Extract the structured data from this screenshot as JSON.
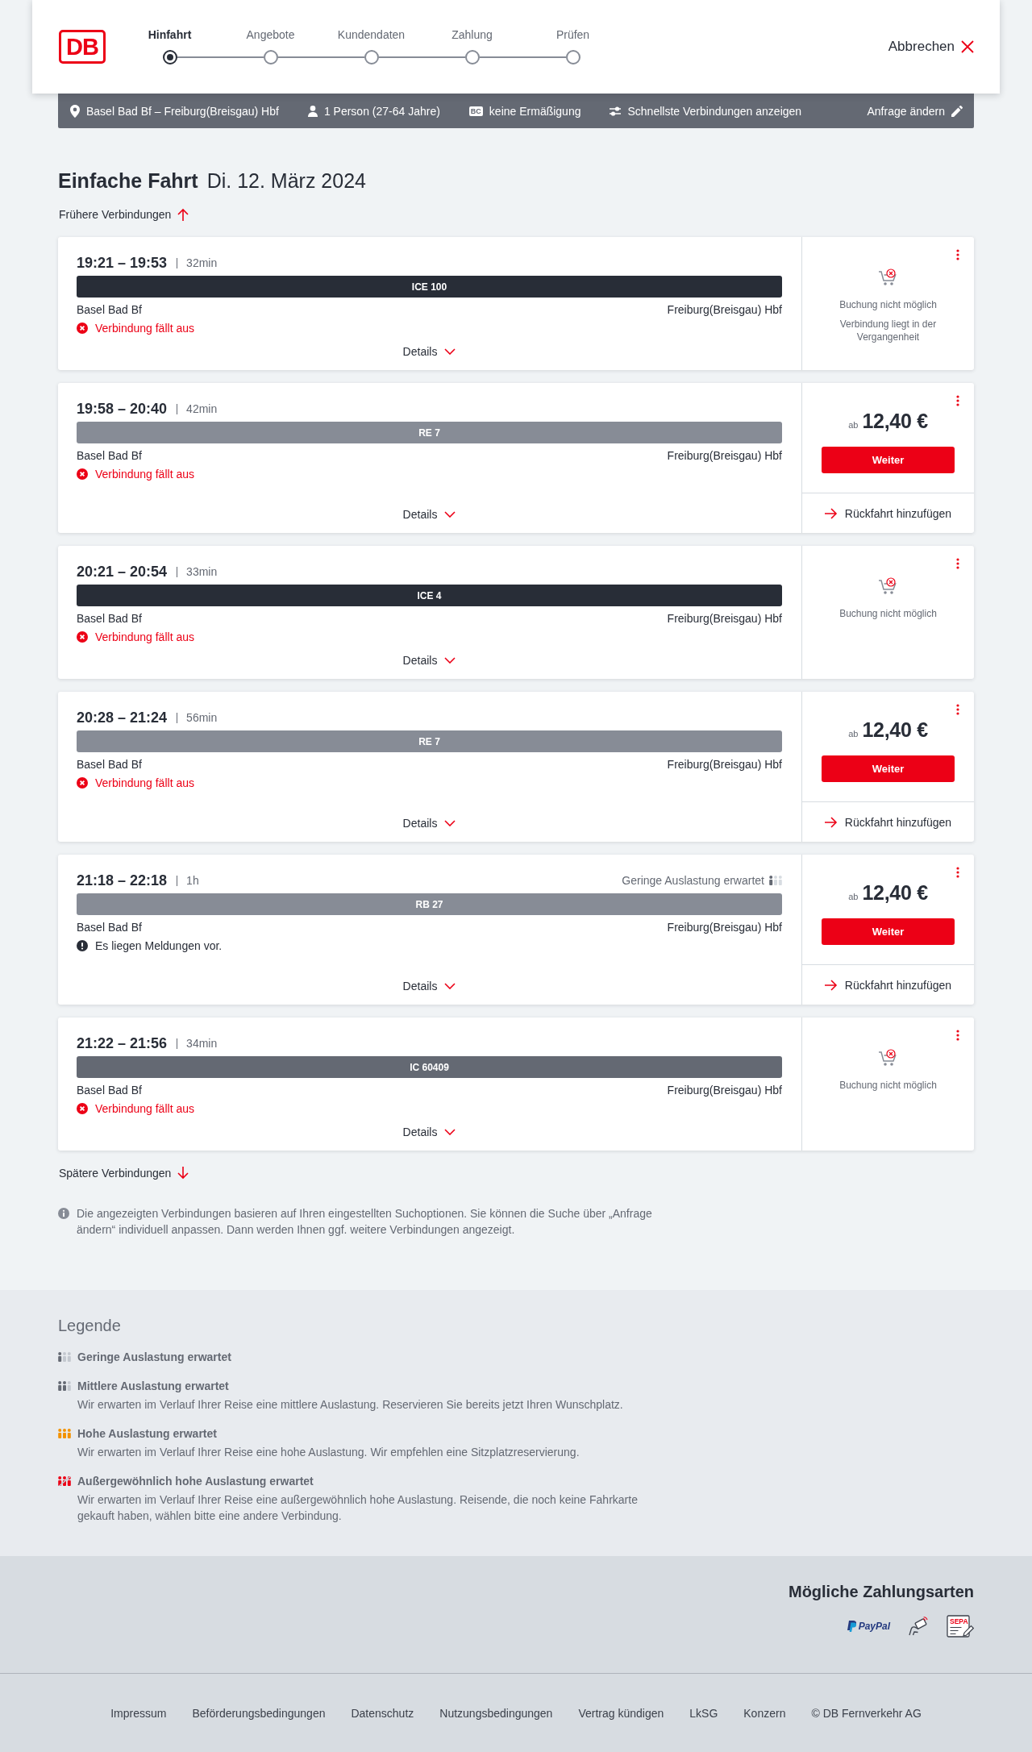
{
  "header": {
    "logo": "DB",
    "steps": [
      {
        "label": "Hinfahrt",
        "selected": true
      },
      {
        "label": "Angebote",
        "selected": false
      },
      {
        "label": "Kundendaten",
        "selected": false
      },
      {
        "label": "Zahlung",
        "selected": false
      },
      {
        "label": "Prüfen",
        "selected": false
      }
    ],
    "cancel": "Abbrechen"
  },
  "search_summary": {
    "route": "Basel Bad Bf – Freiburg(Breisgau) Hbf",
    "travellers": "1 Person (27-64 Jahre)",
    "card_badge": "BC",
    "discount": "keine Ermäßigung",
    "filter": "Schnellste Verbindungen anzeigen",
    "edit": "Anfrage ändern"
  },
  "heading": {
    "title": "Einfache Fahrt",
    "date": "Di. 12. März 2024"
  },
  "earlier_link": "Frühere Verbindungen",
  "connections": [
    {
      "time": "19:21 – 19:53",
      "duration": "32min",
      "train": {
        "label": "ICE 100",
        "color": "#282d37"
      },
      "from": "Basel Bad Bf",
      "to": "Freiburg(Breisgau) Hbf",
      "notice": {
        "kind": "cancelled",
        "text": "Verbindung fällt aus"
      },
      "details": "Details",
      "offer": {
        "kind": "unavailable",
        "status": "Buchung nicht möglich",
        "reason": "Verbindung liegt in der Vergangenheit"
      }
    },
    {
      "time": "19:58 – 20:40",
      "duration": "42min",
      "train": {
        "label": "RE 7",
        "color": "#878c96"
      },
      "from": "Basel Bad Bf",
      "to": "Freiburg(Breisgau) Hbf",
      "notice": {
        "kind": "cancelled",
        "text": "Verbindung fällt aus"
      },
      "details": "Details",
      "offer": {
        "kind": "price",
        "prefix": "ab",
        "price": "12,40 €",
        "button": "Weiter",
        "return_link": "Rückfahrt hinzufügen"
      }
    },
    {
      "time": "20:21 – 20:54",
      "duration": "33min",
      "train": {
        "label": "ICE 4",
        "color": "#282d37"
      },
      "from": "Basel Bad Bf",
      "to": "Freiburg(Breisgau) Hbf",
      "notice": {
        "kind": "cancelled",
        "text": "Verbindung fällt aus"
      },
      "details": "Details",
      "offer": {
        "kind": "unavailable",
        "status": "Buchung nicht möglich"
      }
    },
    {
      "time": "20:28 – 21:24",
      "duration": "56min",
      "train": {
        "label": "RE 7",
        "color": "#878c96"
      },
      "from": "Basel Bad Bf",
      "to": "Freiburg(Breisgau) Hbf",
      "notice": {
        "kind": "cancelled",
        "text": "Verbindung fällt aus"
      },
      "details": "Details",
      "offer": {
        "kind": "price",
        "prefix": "ab",
        "price": "12,40 €",
        "button": "Weiter",
        "return_link": "Rückfahrt hinzufügen"
      }
    },
    {
      "time": "21:18 – 22:18",
      "duration": "1h",
      "occupancy": {
        "kind": "low",
        "text": "Geringe Auslastung erwartet"
      },
      "train": {
        "label": "RB 27",
        "color": "#878c96"
      },
      "from": "Basel Bad Bf",
      "to": "Freiburg(Breisgau) Hbf",
      "notice": {
        "kind": "info",
        "text": "Es liegen Meldungen vor."
      },
      "details": "Details",
      "offer": {
        "kind": "price",
        "prefix": "ab",
        "price": "12,40 €",
        "button": "Weiter",
        "return_link": "Rückfahrt hinzufügen"
      }
    },
    {
      "time": "21:22 – 21:56",
      "duration": "34min",
      "train": {
        "label": "IC 60409",
        "color": "#646973"
      },
      "from": "Basel Bad Bf",
      "to": "Freiburg(Breisgau) Hbf",
      "notice": {
        "kind": "cancelled",
        "text": "Verbindung fällt aus"
      },
      "details": "Details",
      "offer": {
        "kind": "unavailable",
        "status": "Buchung nicht möglich"
      }
    }
  ],
  "later_link": "Spätere Verbindungen",
  "info_note": "Die angezeigten Verbindungen basieren auf Ihren eingestellten Suchoptionen. Sie können die Suche über „Anfrage ändern“ individuell anpassen. Dann werden Ihnen ggf. weitere Verbindungen angezeigt.",
  "legend": {
    "title": "Legende",
    "items": [
      {
        "kind": "low",
        "title": "Geringe Auslastung erwartet"
      },
      {
        "kind": "medium",
        "title": "Mittlere Auslastung erwartet",
        "description": "Wir erwarten im Verlauf Ihrer Reise eine mittlere Auslastung. Reservieren Sie bereits jetzt Ihren Wunschplatz."
      },
      {
        "kind": "high",
        "title": "Hohe Auslastung erwartet",
        "description": "Wir erwarten im Verlauf Ihrer Reise eine hohe Auslastung. Wir empfehlen eine Sitzplatzreservierung."
      },
      {
        "kind": "exceptional",
        "title": "Außergewöhnlich hohe Auslastung erwartet",
        "description": "Wir erwarten im Verlauf Ihrer Reise eine außergewöhnlich hohe Auslastung. Reisende, die noch keine Fahrkarte gekauft haben, wählen bitte eine andere Verbindung."
      }
    ]
  },
  "payment": {
    "title": "Mögliche Zahlungsarten",
    "methods": [
      {
        "kind": "paypal",
        "label": "PayPal"
      },
      {
        "kind": "card"
      },
      {
        "kind": "sepa",
        "label": "SEPA"
      }
    ]
  },
  "footer_links": [
    "Impressum",
    "Beförderungsbedingungen",
    "Datenschutz",
    "Nutzungsbedingungen",
    "Vertrag kündigen",
    "LkSG",
    "Konzern",
    "© DB Fernverkehr AG"
  ]
}
